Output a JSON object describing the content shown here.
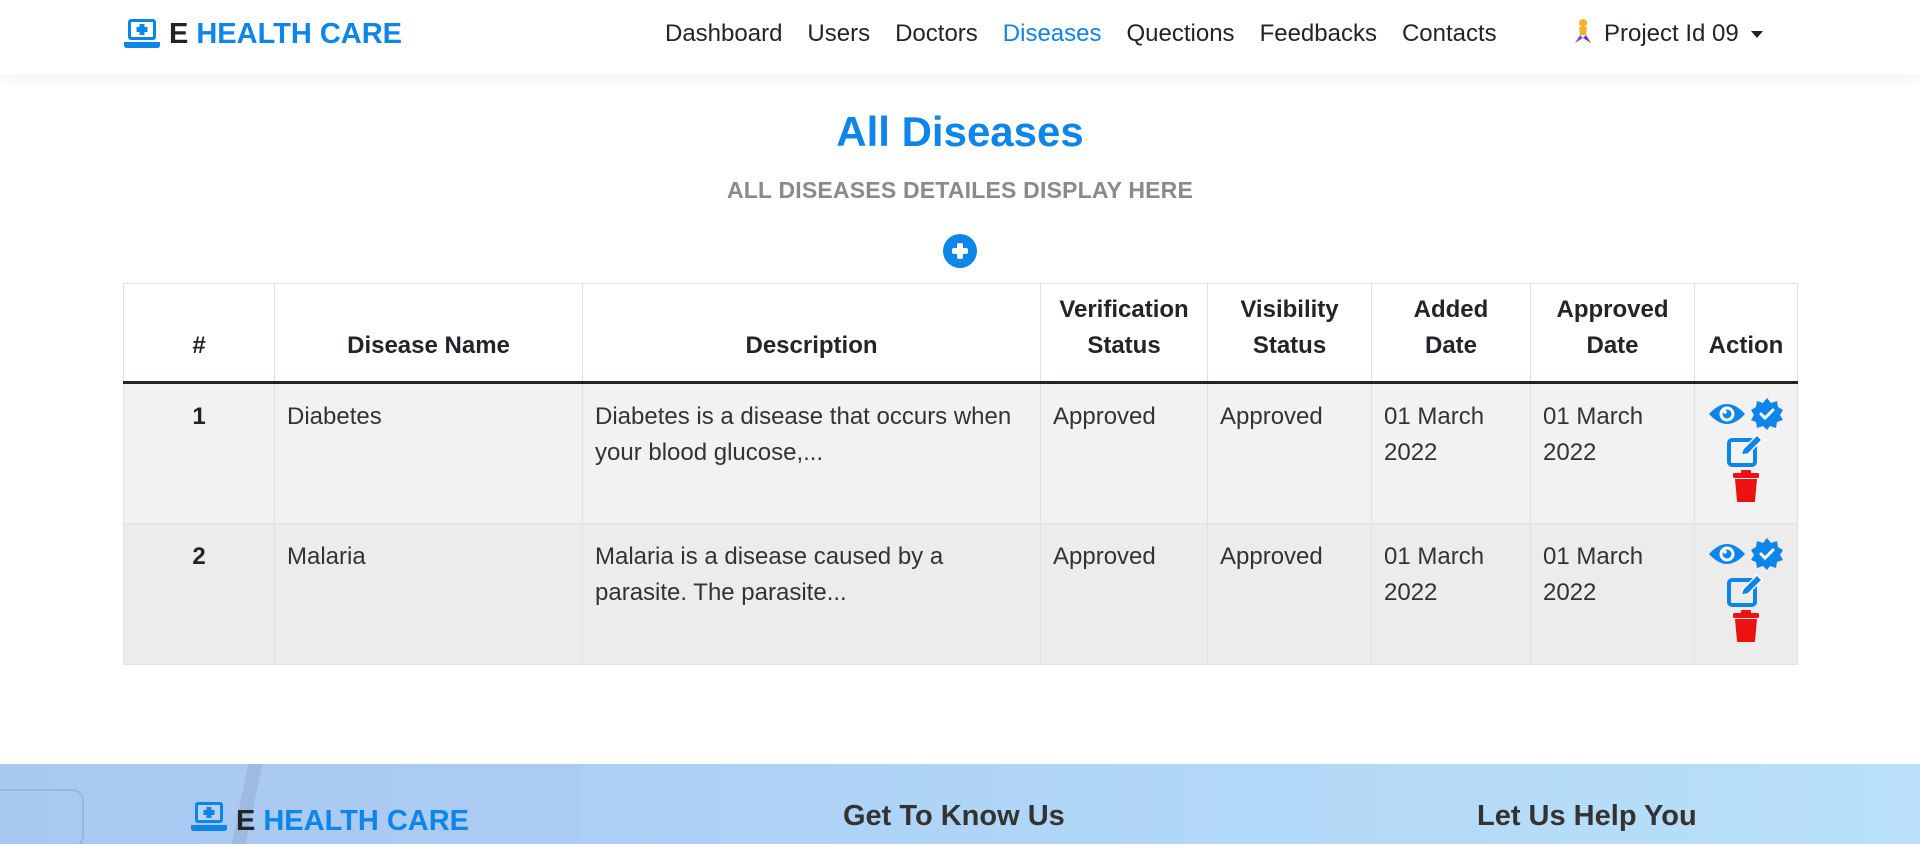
{
  "brand": {
    "e": "E",
    "name": "HEALTH CARE"
  },
  "nav": {
    "items": [
      "Dashboard",
      "Users",
      "Doctors",
      "Diseases",
      "Quections",
      "Feedbacks",
      "Contacts"
    ],
    "active": "Diseases",
    "user_label": "Project Id 09"
  },
  "page": {
    "title": "All Diseases",
    "subtitle": "ALL DISEASES DETAILES DISPLAY HERE"
  },
  "table": {
    "headers": {
      "num": "#",
      "name": "Disease Name",
      "description": "Description",
      "verification_1": "Verification",
      "verification_2": "Status",
      "visibility_1": "Visibility",
      "visibility_2": "Status",
      "added_1": "Added",
      "added_2": "Date",
      "approved_1": "Approved",
      "approved_2": "Date",
      "action": "Action"
    },
    "rows": [
      {
        "num": "1",
        "name": "Diabetes",
        "description": "Diabetes is a disease that occurs when your blood glucose,...",
        "verification": "Approved",
        "visibility": "Approved",
        "added": "01 March 2022",
        "approved": "01 March 2022"
      },
      {
        "num": "2",
        "name": "Malaria",
        "description": "Malaria is a disease caused by a parasite. The parasite...",
        "verification": "Approved",
        "visibility": "Approved",
        "added": "01 March 2022",
        "approved": "01 March 2022"
      }
    ]
  },
  "footer": {
    "brand_e": "E",
    "brand_name": "HEALTH CARE",
    "col2_title": "Get To Know Us",
    "col3_title": "Let Us Help You"
  },
  "colors": {
    "accent": "#0d85e9",
    "danger": "#ee1111",
    "subtitle": "#8a8a8a"
  },
  "icons": {
    "brand": "laptop-medical-icon",
    "add": "plus-circle-icon",
    "view": "eye-icon",
    "verify": "certificate-icon",
    "edit": "edit-icon",
    "delete": "trash-icon"
  }
}
